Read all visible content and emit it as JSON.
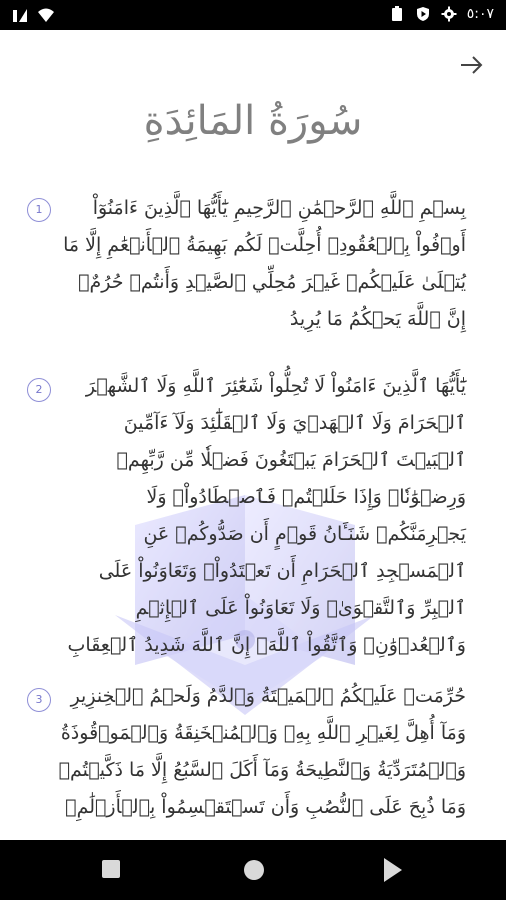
{
  "status_bar": {
    "time": "٥:٠٧",
    "left_icons": [
      "signal-icon",
      "wifi-icon"
    ],
    "right_icons": [
      "battery-icon",
      "play-protect-icon",
      "settings-icon"
    ]
  },
  "header": {
    "back_icon": "arrow-right-icon",
    "surah_title": "سُورَةُ المَائِدَةِ"
  },
  "ayahs": [
    {
      "number": "1",
      "text": "بِسۡمِ ٱللَّهِ ٱلرَّحۡمَٰنِ ٱلرَّحِيمِ يَٰٓأَيُّهَا ٱلَّذِينَ ءَامَنُوٓاْ أَوۡفُواْ بِٱلۡعُقُودِۚ أُحِلَّتۡ لَكُم بَهِيمَةُ ٱلۡأَنۡعَٰمِ إِلَّا مَا يُتۡلَىٰ عَلَيۡكُمۡ غَيۡرَ مُحِلِّي ٱلصَّيۡدِ وَأَنتُمۡ حُرُمٌۗ إِنَّ ٱللَّهَ يَحۡكُمُ مَا يُرِيدُ"
    },
    {
      "number": "2",
      "text": "يَٰٓأَيُّهَا ٱلَّذِينَ ءَامَنُواْ لَا تُحِلُّواْ شَعَٰٓئِرَ ٱللَّهِ وَلَا ٱلشَّهۡرَ ٱلۡحَرَامَ وَلَا ٱلۡهَدۡيَ وَلَا ٱلۡقَلَٰٓئِدَ وَلَآ ءَآمِّينَ ٱلۡبَيۡتَ ٱلۡحَرَامَ يَبۡتَغُونَ فَضۡلٗا مِّن رَّبِّهِمۡ وَرِضۡوَٰنٗاۚ وَإِذَا حَلَلۡتُمۡ فَٱصۡطَادُواْۚ وَلَا يَجۡرِمَنَّكُمۡ شَنَـَٔانُ قَوۡمٍ أَن صَدُّوكُمۡ عَنِ ٱلۡمَسۡجِدِ ٱلۡحَرَامِ أَن تَعۡتَدُواْۘ وَتَعَاوَنُواْ عَلَى ٱلۡبِرِّ وَٱلتَّقۡوَىٰۖ وَلَا تَعَاوَنُواْ عَلَى ٱلۡإِثۡمِ وَٱلۡعُدۡوَٰنِۚ وَٱتَّقُواْ ٱللَّهَۖ إِنَّ ٱللَّهَ شَدِيدُ ٱلۡعِقَابِ"
    },
    {
      "number": "3",
      "text": "حُرِّمَتۡ عَلَيۡكُمُ ٱلۡمَيۡتَةُ وَٱلدَّمُ وَلَحۡمُ ٱلۡخِنزِيرِ وَمَآ أُهِلَّ لِغَيۡرِ ٱللَّهِ بِهِۦ وَٱلۡمُنۡخَنِقَةُ وَٱلۡمَوۡقُوذَةُ وَٱلۡمُتَرَدِّيَةُ وَٱلنَّطِيحَةُ وَمَآ أَكَلَ ٱلسَّبُعُ إِلَّا مَا ذَكَّيۡتُمۡ وَمَا ذُبِحَ عَلَى ٱلنُّصُبِ وَأَن تَسۡتَقۡسِمُواْ بِٱلۡأَزۡلَٰمِۚ"
    }
  ],
  "nav_bar": {
    "icons": [
      "recents-square-icon",
      "home-circle-icon",
      "back-triangle-icon"
    ]
  },
  "colors": {
    "text": "#333333",
    "title": "#808080",
    "ayah_number": "#7777cc",
    "bars": "#000000"
  }
}
